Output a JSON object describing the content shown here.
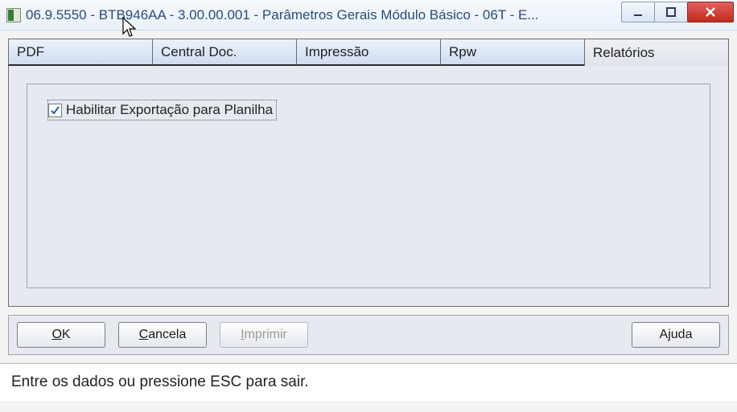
{
  "window": {
    "title": "06.9.5550 - BTB946AA - 3.00.00.001 - Parâmetros Gerais Módulo Básico - 06T - E..."
  },
  "tabs": [
    {
      "label": "PDF",
      "active": false
    },
    {
      "label": "Central Doc.",
      "active": false
    },
    {
      "label": "Impressão",
      "active": false
    },
    {
      "label": "Rpw",
      "active": false
    },
    {
      "label": "Relatórios",
      "active": true
    }
  ],
  "content": {
    "checkbox": {
      "label": "Habilitar Exportação para Planilha",
      "checked": true
    }
  },
  "buttons": {
    "ok": {
      "pre": "",
      "mn": "O",
      "post": "K"
    },
    "cancel": {
      "pre": "",
      "mn": "C",
      "post": "ancela"
    },
    "print": {
      "pre": "",
      "mn": "I",
      "post": "mprimir",
      "disabled": true
    },
    "help": {
      "pre": "A",
      "mn": "j",
      "post": "uda"
    }
  },
  "status": "Entre os dados ou pressione ESC para sair."
}
